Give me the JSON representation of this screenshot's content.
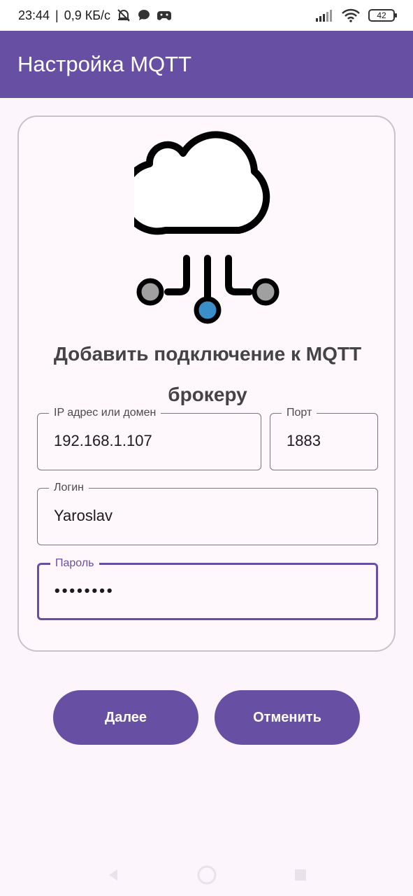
{
  "status_bar": {
    "time": "23:44",
    "separator": "|",
    "speed": "0,9 КБ/с",
    "battery": "42",
    "icons": [
      "mute-bell-icon",
      "chat-bubble-icon",
      "game-controller-icon",
      "signal-icon",
      "wifi-icon",
      "battery-icon"
    ]
  },
  "app_bar": {
    "title": "Настройка MQTT"
  },
  "card": {
    "icon": "cloud-network-icon",
    "title_line1": "Добавить подключение к MQTT",
    "title_line2": "брокеру"
  },
  "fields": {
    "host": {
      "label": "IP адрес или домен",
      "value": "192.168.1.107"
    },
    "port": {
      "label": "Порт",
      "value": "1883"
    },
    "login": {
      "label": "Логин",
      "value": "Yaroslav"
    },
    "password": {
      "label": "Пароль",
      "value": "••••••••"
    }
  },
  "buttons": {
    "next": "Далее",
    "cancel": "Отменить"
  },
  "nav": {
    "icons": [
      "back-icon",
      "home-icon",
      "recents-icon"
    ]
  },
  "colors": {
    "primary": "#6750A4",
    "background": "#FCF6FC",
    "outline": "#7A757F",
    "node_gray": "#A0A0A0",
    "node_blue": "#3A8FC8"
  }
}
